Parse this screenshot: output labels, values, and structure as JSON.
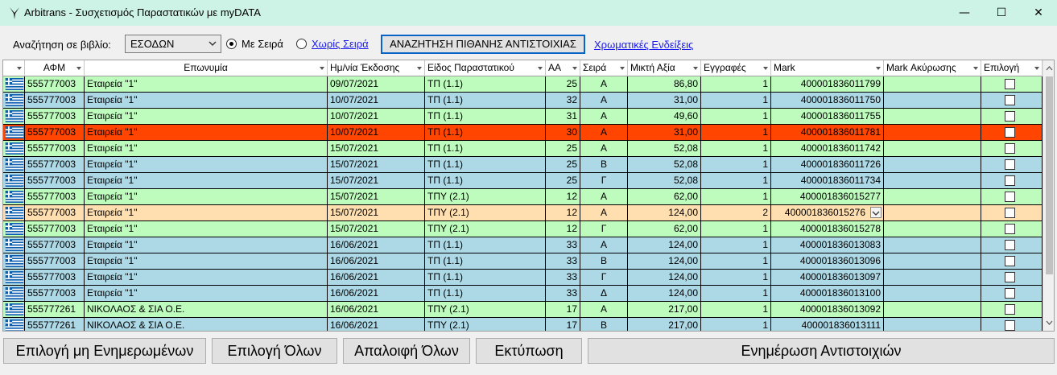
{
  "window": {
    "title": "Arbitrans - Συσχετισμός Παραστατικών με myDATA",
    "minimize": "—",
    "maximize": "☐",
    "close": "✕"
  },
  "toolbar": {
    "search_label": "Αναζήτηση σε βιβλίο:",
    "book_value": "ΕΣΟΔΩΝ",
    "radio_with_series": "Με Σειρά",
    "radio_without_series": "Χωρίς Σειρά",
    "search_button": "ΑΝΑΖΗΤΗΣΗ ΠΙΘΑΝΗΣ ΑΝΤΙΣΤΟΙΧΙΑΣ",
    "legend_link": "Χρωματικές Ενδείξεις"
  },
  "grid": {
    "columns": [
      "",
      "ΑΦΜ",
      "Επωνυμία",
      "Ημ/νία Έκδοσης",
      "Είδος Παραστατικού",
      "ΑΑ",
      "Σειρά",
      "Μικτή Αξία",
      "Εγγραφές",
      "Mark",
      "Mark Ακύρωσης",
      "Επιλογή"
    ],
    "row_colors": {
      "green": "#bdfcbd",
      "blue": "#add8e6",
      "red": "#ff4500",
      "orange": "#ffdeaf"
    },
    "rows": [
      {
        "afm": "555777003",
        "name": "Εταιρεία \"1\"",
        "date": "09/07/2021",
        "type": "ΤΠ (1.1)",
        "aa": "25",
        "series": "Α",
        "amount": "86,80",
        "entries": "1",
        "mark": "400001836011799",
        "color": "green"
      },
      {
        "afm": "555777003",
        "name": "Εταιρεία \"1\"",
        "date": "10/07/2021",
        "type": "ΤΠ (1.1)",
        "aa": "32",
        "series": "Α",
        "amount": "31,00",
        "entries": "1",
        "mark": "400001836011750",
        "color": "blue"
      },
      {
        "afm": "555777003",
        "name": "Εταιρεία \"1\"",
        "date": "10/07/2021",
        "type": "ΤΠ (1.1)",
        "aa": "31",
        "series": "Α",
        "amount": "49,60",
        "entries": "1",
        "mark": "400001836011755",
        "color": "green"
      },
      {
        "afm": "555777003",
        "name": "Εταιρεία \"1\"",
        "date": "10/07/2021",
        "type": "ΤΠ (1.1)",
        "aa": "30",
        "series": "Α",
        "amount": "31,00",
        "entries": "1",
        "mark": "400001836011781",
        "color": "red"
      },
      {
        "afm": "555777003",
        "name": "Εταιρεία \"1\"",
        "date": "15/07/2021",
        "type": "ΤΠ (1.1)",
        "aa": "25",
        "series": "Α",
        "amount": "52,08",
        "entries": "1",
        "mark": "400001836011742",
        "color": "green"
      },
      {
        "afm": "555777003",
        "name": "Εταιρεία \"1\"",
        "date": "15/07/2021",
        "type": "ΤΠ (1.1)",
        "aa": "25",
        "series": "Β",
        "amount": "52,08",
        "entries": "1",
        "mark": "400001836011726",
        "color": "blue"
      },
      {
        "afm": "555777003",
        "name": "Εταιρεία \"1\"",
        "date": "15/07/2021",
        "type": "ΤΠ (1.1)",
        "aa": "25",
        "series": "Γ",
        "amount": "52,08",
        "entries": "1",
        "mark": "400001836011734",
        "color": "blue"
      },
      {
        "afm": "555777003",
        "name": "Εταιρεία \"1\"",
        "date": "15/07/2021",
        "type": "ΤΠΥ (2.1)",
        "aa": "12",
        "series": "Α",
        "amount": "62,00",
        "entries": "1",
        "mark": "400001836015277",
        "color": "green"
      },
      {
        "afm": "555777003",
        "name": "Εταιρεία \"1\"",
        "date": "15/07/2021",
        "type": "ΤΠΥ (2.1)",
        "aa": "12",
        "series": "Α",
        "amount": "124,00",
        "entries": "2",
        "mark": "400001836015276",
        "color": "orange",
        "mark_dropdown": true
      },
      {
        "afm": "555777003",
        "name": "Εταιρεία \"1\"",
        "date": "15/07/2021",
        "type": "ΤΠΥ (2.1)",
        "aa": "12",
        "series": "Γ",
        "amount": "62,00",
        "entries": "1",
        "mark": "400001836015278",
        "color": "green"
      },
      {
        "afm": "555777003",
        "name": "Εταιρεία \"1\"",
        "date": "16/06/2021",
        "type": "ΤΠ (1.1)",
        "aa": "33",
        "series": "Α",
        "amount": "124,00",
        "entries": "1",
        "mark": "400001836013083",
        "color": "blue"
      },
      {
        "afm": "555777003",
        "name": "Εταιρεία \"1\"",
        "date": "16/06/2021",
        "type": "ΤΠ (1.1)",
        "aa": "33",
        "series": "Β",
        "amount": "124,00",
        "entries": "1",
        "mark": "400001836013096",
        "color": "blue"
      },
      {
        "afm": "555777003",
        "name": "Εταιρεία \"1\"",
        "date": "16/06/2021",
        "type": "ΤΠ (1.1)",
        "aa": "33",
        "series": "Γ",
        "amount": "124,00",
        "entries": "1",
        "mark": "400001836013097",
        "color": "blue"
      },
      {
        "afm": "555777003",
        "name": "Εταιρεία \"1\"",
        "date": "16/06/2021",
        "type": "ΤΠ (1.1)",
        "aa": "33",
        "series": "Δ",
        "amount": "124,00",
        "entries": "1",
        "mark": "400001836013100",
        "color": "blue"
      },
      {
        "afm": "555777261",
        "name": "ΝΙΚΟΛΑΟΣ & ΣΙΑ Ο.Ε.",
        "date": "16/06/2021",
        "type": "ΤΠΥ (2.1)",
        "aa": "17",
        "series": "Α",
        "amount": "217,00",
        "entries": "1",
        "mark": "400001836013092",
        "color": "green"
      },
      {
        "afm": "555777261",
        "name": "ΝΙΚΟΛΑΟΣ & ΣΙΑ Ο.Ε.",
        "date": "16/06/2021",
        "type": "ΤΠΥ (2.1)",
        "aa": "17",
        "series": "Β",
        "amount": "217,00",
        "entries": "1",
        "mark": "400001836013111",
        "color": "blue"
      }
    ]
  },
  "bottom": {
    "select_unupdated": "Επιλογή μη Ενημερωμένων",
    "select_all": "Επιλογή Όλων",
    "clear_all": "Απαλοιφή Όλων",
    "print": "Εκτύπωση",
    "update_matches": "Ενημέρωση Αντιστοιχιών"
  }
}
